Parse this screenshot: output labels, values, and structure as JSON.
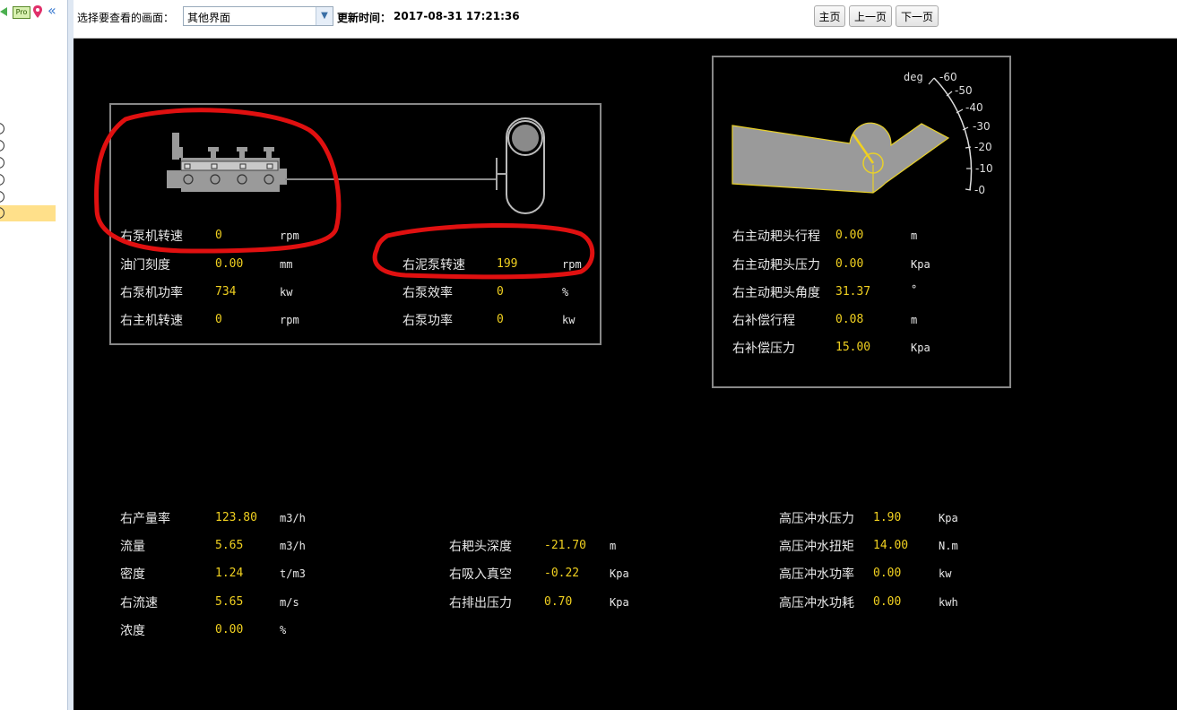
{
  "toolbar": {
    "select_label": "选择要查看的画面：",
    "select_value": "其他界面",
    "update_label": "更新时间：",
    "update_time": "2017-08-31 17:21:36",
    "home_btn": "主页",
    "prev_btn": "上一页",
    "next_btn": "下一页"
  },
  "sidebar": {
    "pro_badge": "Pro"
  },
  "pump_box": {
    "rows_left": [
      {
        "label": "右泵机转速",
        "value": "0",
        "unit": "rpm"
      },
      {
        "label": "油门刻度",
        "value": "0.00",
        "unit": "mm"
      },
      {
        "label": "右泵机功率",
        "value": "734",
        "unit": "kw"
      },
      {
        "label": "右主机转速",
        "value": "0",
        "unit": "rpm"
      }
    ],
    "rows_right": [
      {
        "label": "右泥泵转速",
        "value": "199",
        "unit": "rpm"
      },
      {
        "label": "右泵效率",
        "value": "0",
        "unit": "%"
      },
      {
        "label": "右泵功率",
        "value": "0",
        "unit": "kw"
      }
    ]
  },
  "drag_box": {
    "gauge_unit": "deg",
    "gauge_ticks": [
      "-60",
      "-50",
      "-40",
      "-30",
      "-20",
      "-10",
      "-0"
    ],
    "rows": [
      {
        "label": "右主动耙头行程",
        "value": "0.00",
        "unit": "m"
      },
      {
        "label": "右主动耙头压力",
        "value": "0.00",
        "unit": "Kpa"
      },
      {
        "label": "右主动耙头角度",
        "value": "31.37",
        "unit": "°"
      },
      {
        "label": "右补偿行程",
        "value": "0.08",
        "unit": "m"
      },
      {
        "label": "右补偿压力",
        "value": "15.00",
        "unit": "Kpa"
      }
    ]
  },
  "bottom_left": [
    {
      "label": "右产量率",
      "value": "123.80",
      "unit": "m3/h"
    },
    {
      "label": "流量",
      "value": "5.65",
      "unit": "m3/h"
    },
    {
      "label": "密度",
      "value": "1.24",
      "unit": "t/m3"
    },
    {
      "label": "右流速",
      "value": "5.65",
      "unit": "m/s"
    },
    {
      "label": "浓度",
      "value": "0.00",
      "unit": "%"
    }
  ],
  "bottom_mid": [
    {
      "label": "右耙头深度",
      "value": "-21.70",
      "unit": "m"
    },
    {
      "label": "右吸入真空",
      "value": "-0.22",
      "unit": "Kpa"
    },
    {
      "label": "右排出压力",
      "value": "0.70",
      "unit": "Kpa"
    }
  ],
  "bottom_right": [
    {
      "label": "高压冲水压力",
      "value": "1.90",
      "unit": "Kpa"
    },
    {
      "label": "高压冲水扭矩",
      "value": "14.00",
      "unit": "N.m"
    },
    {
      "label": "高压冲水功率",
      "value": "0.00",
      "unit": "kw"
    },
    {
      "label": "高压冲水功耗",
      "value": "0.00",
      "unit": "kwh"
    }
  ],
  "colors": {
    "value_yellow": "#f0d020",
    "annotation_red": "#e01010",
    "panel_bg": "#000000"
  }
}
